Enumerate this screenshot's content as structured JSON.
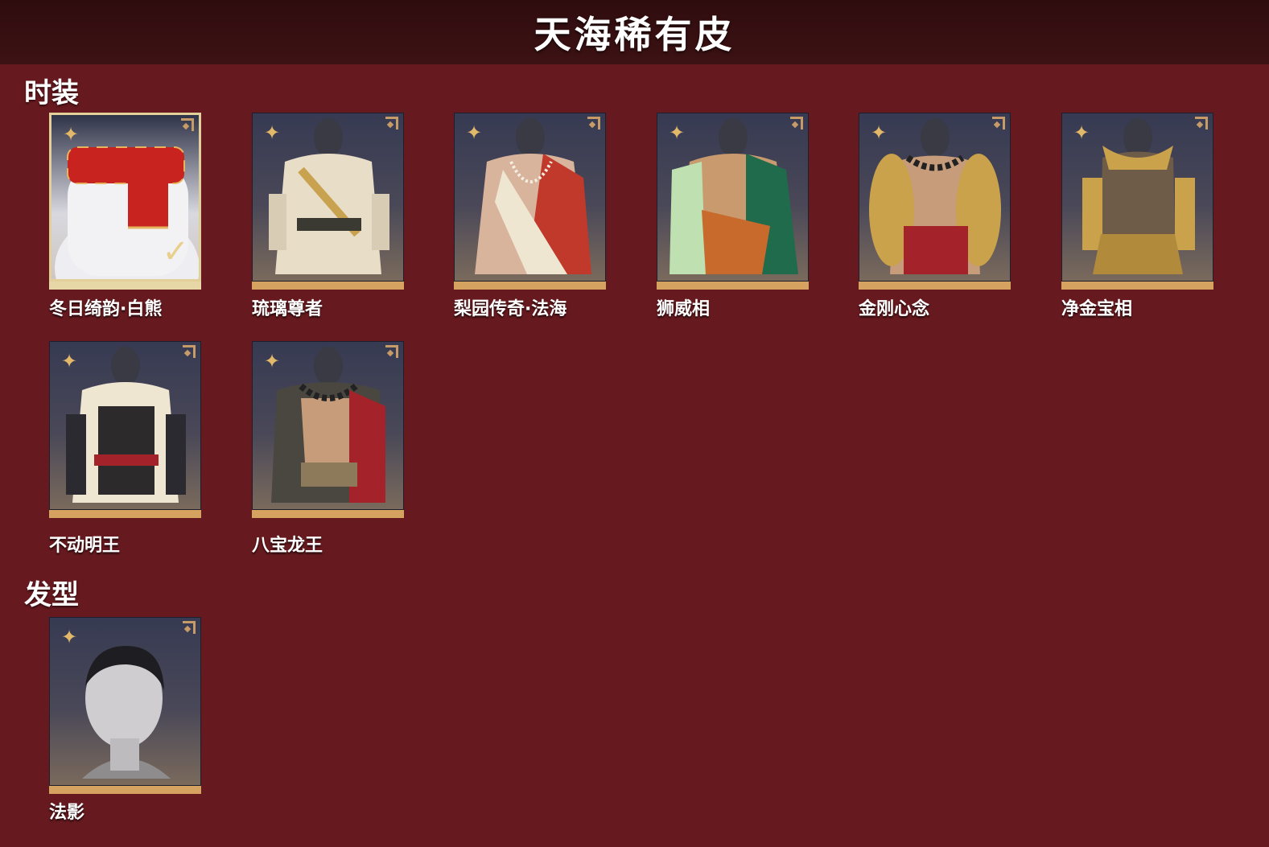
{
  "header": {
    "title": "天海稀有皮"
  },
  "sections": {
    "costume": {
      "title": "时装",
      "items": [
        {
          "name": "冬日绮韵·白熊",
          "selected": true
        },
        {
          "name": "琉璃尊者",
          "selected": false
        },
        {
          "name": "梨园传奇·法海",
          "selected": false
        },
        {
          "name": "狮威相",
          "selected": false
        },
        {
          "name": "金刚心念",
          "selected": false
        },
        {
          "name": "净金宝相",
          "selected": false
        },
        {
          "name": "不动明王",
          "selected": false
        },
        {
          "name": "八宝龙王",
          "selected": false
        }
      ]
    },
    "hair": {
      "title": "发型",
      "items": [
        {
          "name": "法影",
          "selected": false
        }
      ]
    }
  },
  "icons": {
    "rarity": "four-petal-star-icon",
    "selected": "checkmark-icon",
    "corner": "corner-badge-icon"
  },
  "colors": {
    "background": "#661a1f",
    "header": "#3a1012",
    "rarity_gold": "#e2b869",
    "frame_bar": "#d6a25f"
  }
}
